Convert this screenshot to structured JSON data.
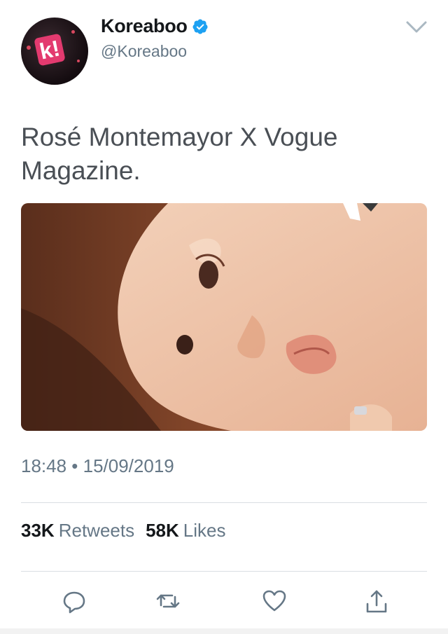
{
  "author": {
    "display_name": "Koreaboo",
    "handle": "@Koreaboo",
    "verified": true,
    "avatar_icon": "koreaboo-logo"
  },
  "tweet": {
    "text": "Rosé Montemayor X Vogue Magazine.",
    "media_icon": "photo-portrait",
    "timestamp": "18:48 • 15/09/2019"
  },
  "stats": {
    "retweets_count": "33K",
    "retweets_label": "Retweets",
    "likes_count": "58K",
    "likes_label": "Likes"
  },
  "actions": [
    "reply-icon",
    "retweet-icon",
    "like-icon",
    "share-icon"
  ],
  "colors": {
    "text_primary": "#14171a",
    "text_secondary": "#657786",
    "verified_blue": "#1da1f2",
    "divider": "#d9dee3"
  }
}
